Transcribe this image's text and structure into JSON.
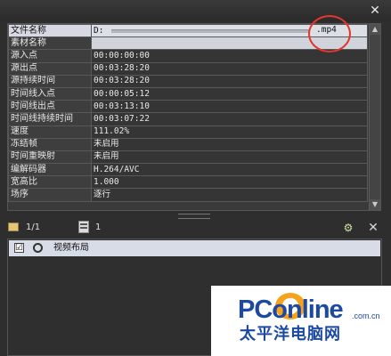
{
  "titlebar": {
    "close_icon": "close-icon"
  },
  "properties": [
    {
      "key": "文件名称",
      "value": "D:",
      "ext": ".mp4"
    },
    {
      "key": "素材名称",
      "value": ""
    },
    {
      "key": "源入点",
      "value": "00:00:00:00"
    },
    {
      "key": "源出点",
      "value": "00:03:28:20"
    },
    {
      "key": "源持续时间",
      "value": "00:03:28:20"
    },
    {
      "key": "时间线入点",
      "value": "00:00:05:12"
    },
    {
      "key": "时间线出点",
      "value": "00:03:13:10"
    },
    {
      "key": "时间线持续时间",
      "value": "00:03:07:22"
    },
    {
      "key": "速度",
      "value": "111.02%"
    },
    {
      "key": "冻结帧",
      "value": "未启用"
    },
    {
      "key": "时间重映射",
      "value": "未启用"
    },
    {
      "key": "编解码器",
      "value": "H.264/AVC"
    },
    {
      "key": "宽高比",
      "value": "1.000"
    },
    {
      "key": "场序",
      "value": "逐行"
    }
  ],
  "toolbar": {
    "page_count": "1/1",
    "clip_count": "1"
  },
  "effects": [
    {
      "label": "视频布局",
      "checked": "☑"
    }
  ],
  "watermark": {
    "logo": "PConline",
    "domain": ".com.cn",
    "sub": "太平洋电脑网"
  },
  "colors": {
    "highlight_circle": "#e3372e",
    "brand_blue": "#1b4aa0"
  }
}
